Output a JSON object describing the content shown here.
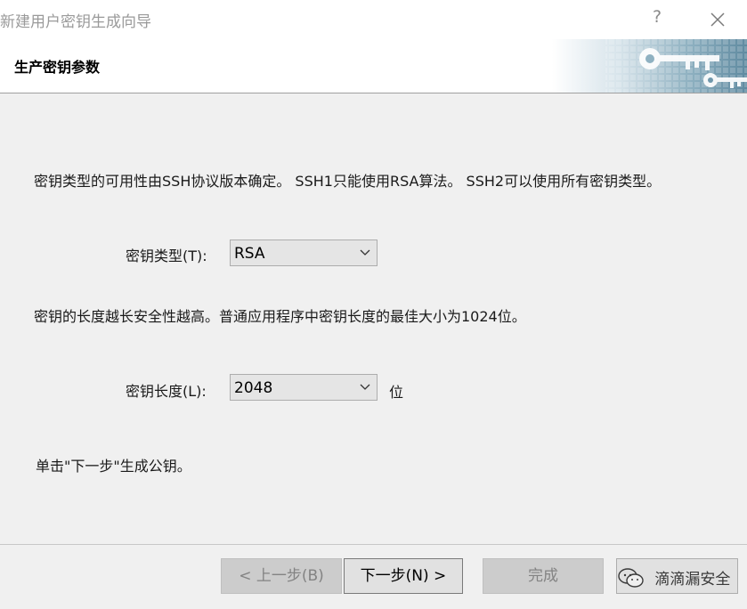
{
  "window": {
    "title": "新建用户密钥生成向导",
    "help": "?"
  },
  "header": {
    "heading": "生产密钥参数"
  },
  "content": {
    "type_description": "密钥类型的可用性由SSH协议版本确定。 SSH1只能使用RSA算法。 SSH2可以使用所有密钥类型。",
    "type_label": "密钥类型(T):",
    "type_value": "RSA",
    "length_description": "密钥的长度越长安全性越高。普通应用程序中密钥长度的最佳大小为1024位。",
    "length_label": "密钥长度(L):",
    "length_value": "2048",
    "length_unit": "位",
    "instruction": "单击\"下一步\"生成公钥。"
  },
  "buttons": {
    "back": "< 上一步(B)",
    "next": "下一步(N) >",
    "finish": "完成"
  },
  "watermark": {
    "text": "滴滴漏安全"
  },
  "colors": {
    "background": "#f0f0f0",
    "header_background": "#ffffff",
    "banner_blue": "#6a93a6",
    "disabled_button": "#cccccc"
  },
  "icons": [
    "help-icon",
    "close-icon",
    "key-banner",
    "chevron-down-icon",
    "wechat-icon"
  ]
}
